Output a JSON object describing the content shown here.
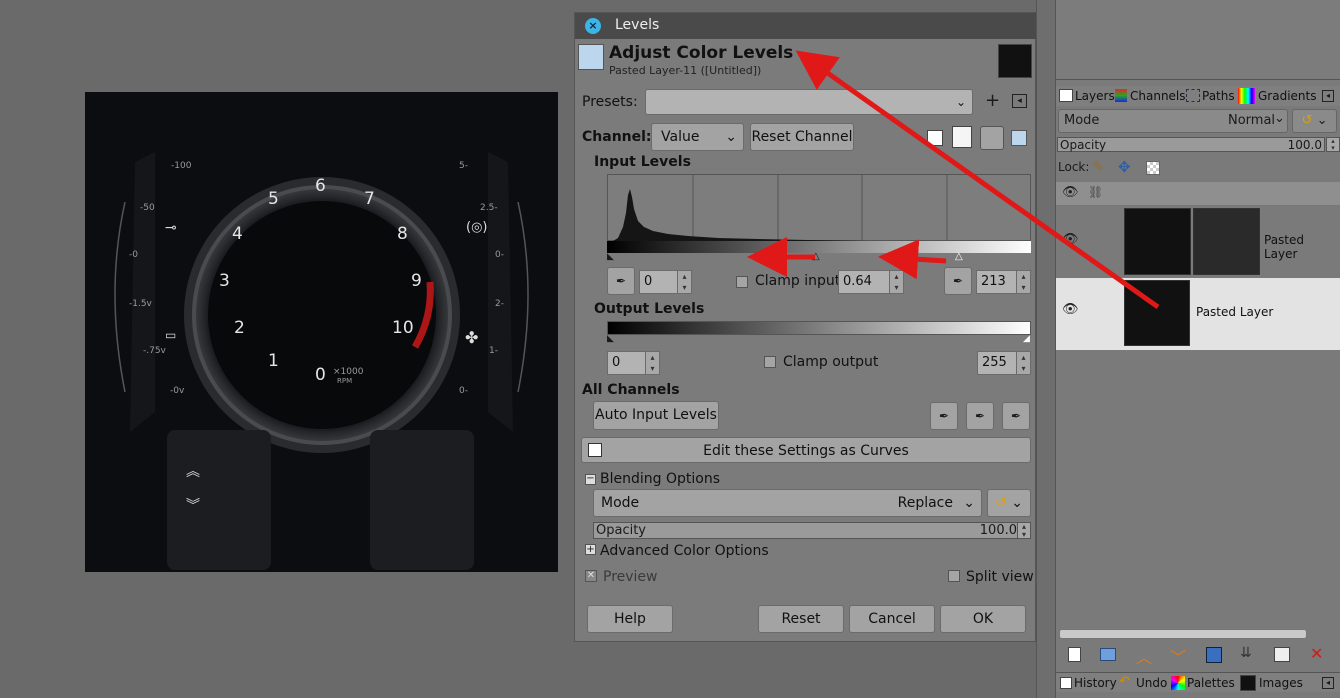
{
  "gauge": {
    "numbers": [
      "6",
      "5",
      "7",
      "4",
      "8",
      "3",
      "9",
      "2",
      "10",
      "1",
      "0"
    ],
    "unit_top": "×1000",
    "unit_bottom": "RPM",
    "left_labels": [
      "-100",
      "-50",
      "-0",
      "-1.5v",
      "-.75v",
      "-0v"
    ],
    "right_labels": [
      "5-",
      "2.5-",
      "0-",
      "2-",
      "1-",
      "0-"
    ]
  },
  "dialog": {
    "title": "Levels",
    "heading": "Adjust Color Levels",
    "subheading": "Pasted Layer-11 ([Untitled])",
    "presets_label": "Presets:",
    "presets_value": "",
    "channel_label": "Channel:",
    "channel_value": "Value",
    "reset_channel": "Reset Channel",
    "input_levels": "Input Levels",
    "input_low": "0",
    "clamp_input": "Clamp input",
    "gamma": "0.64",
    "input_high": "213",
    "output_levels": "Output Levels",
    "output_low": "0",
    "clamp_output": "Clamp output",
    "output_high": "255",
    "all_channels": "All Channels",
    "auto_input": "Auto Input Levels",
    "edit_curves": "Edit these Settings as Curves",
    "blending_options": "Blending Options",
    "mode_label": "Mode",
    "mode_value": "Replace",
    "opacity_label": "Opacity",
    "opacity_value": "100.0",
    "advanced": "Advanced Color Options",
    "preview": "Preview",
    "split_view": "Split view",
    "help": "Help",
    "reset": "Reset",
    "cancel": "Cancel",
    "ok": "OK"
  },
  "dock": {
    "tabs": [
      "Layers",
      "Channels",
      "Paths",
      "Gradients"
    ],
    "mode_label": "Mode",
    "mode_value": "Normal",
    "opacity_label": "Opacity",
    "opacity_value": "100.0",
    "lock_label": "Lock:",
    "layers": [
      "Pasted Layer",
      "Pasted Layer"
    ],
    "bottom_tabs": [
      "History",
      "Undo",
      "Palettes",
      "Images"
    ]
  },
  "colors": {
    "annotation_arrow": "#e01818",
    "accent": "#3cb4e6"
  }
}
